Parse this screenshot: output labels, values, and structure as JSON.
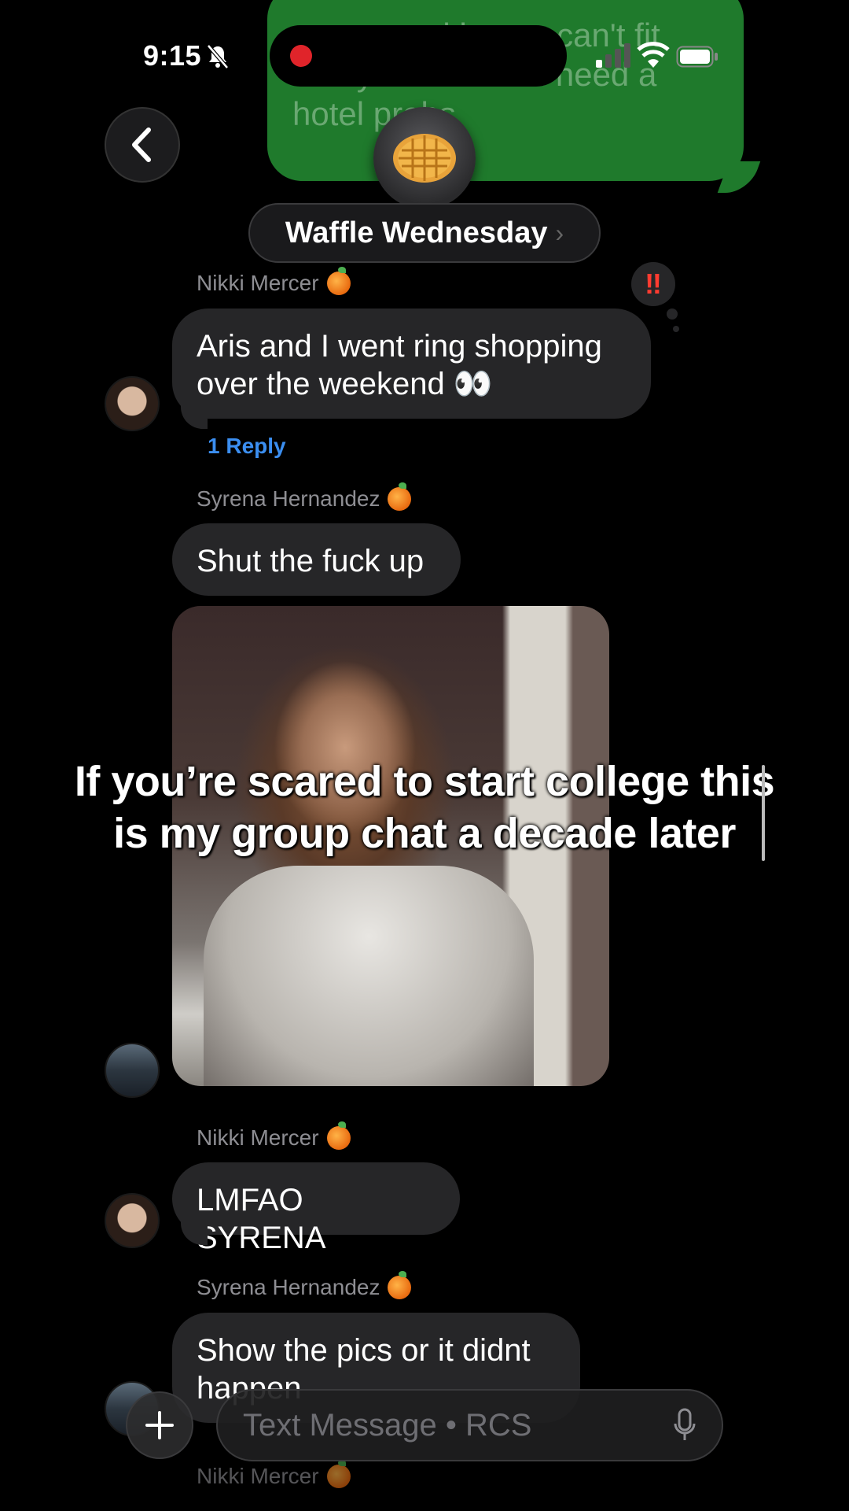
{
  "status_bar": {
    "time": "9:15"
  },
  "top_sent_message": {
    "text": "… room with a … can't fit everyone … we'd need a hotel probs"
  },
  "header": {
    "group_name": "Waffle Wednesday",
    "chevron": "›",
    "group_icon": "waffle"
  },
  "messages": [
    {
      "sender": "Nikki Mercer",
      "text": "Aris and I went ring shopping over the weekend 👀",
      "reaction": "‼",
      "reply_label": "1 Reply"
    },
    {
      "sender": "Syrena Hernandez",
      "text": "Shut the fuck up"
    },
    {
      "sender": "Nikki Mercer",
      "text": "LMFAO SYRENA"
    },
    {
      "sender": "Syrena Hernandez",
      "text": "Show the pics or it didnt happen"
    },
    {
      "sender": "Nikki Mercer"
    }
  ],
  "caption": {
    "line1": "If you’re scared to start college this",
    "line2": "is my group chat a decade later"
  },
  "composer": {
    "placeholder": "Text Message • RCS"
  },
  "colors": {
    "background": "#000000",
    "received_bubble": "#262628",
    "sent_bubble": "#1f7a2c",
    "link": "#3b8ef0",
    "recording_dot": "#e0242a"
  }
}
